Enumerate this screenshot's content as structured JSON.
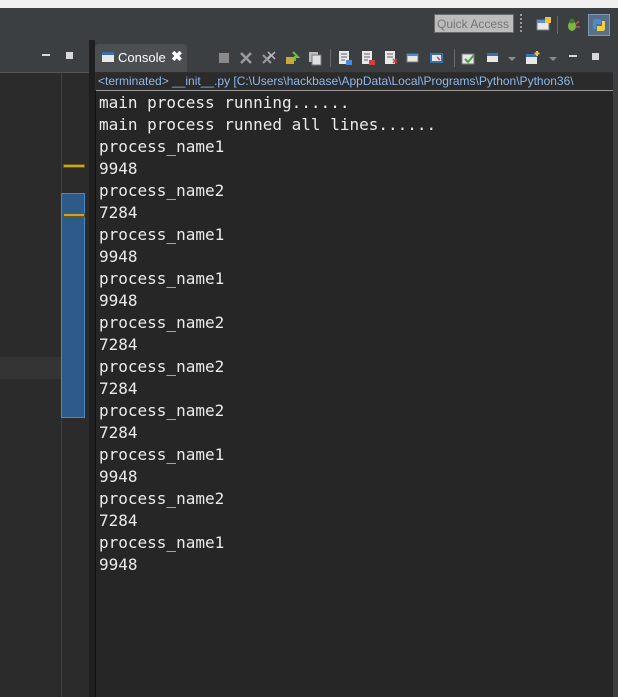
{
  "toolbar": {
    "quick_access_placeholder": "Quick Access",
    "icons": [
      "open-perspective-icon",
      "debug-perspective-icon",
      "python-perspective-icon"
    ]
  },
  "console": {
    "tab_label": "Console",
    "close_glyph": "✖",
    "toolbar_icons": [
      "terminate-icon",
      "remove-launch-icon",
      "remove-all-terminated-icon",
      "scroll-lock-icon",
      "clear-console-icon",
      "show-console-on-stdout-icon",
      "show-console-on-stderr-icon",
      "word-wrap-icon",
      "pin-console-icon",
      "display-selected-console-icon",
      "open-console-icon"
    ],
    "status": "<terminated> __init__.py [C:\\Users\\hackbase\\AppData\\Local\\Programs\\Python\\Python36\\",
    "lines": [
      "main process running......",
      "main process runned all lines......",
      "process_name1",
      "9948",
      "process_name2",
      "7284",
      "process_name1",
      "9948",
      "process_name1",
      "9948",
      "process_name2",
      "7284",
      "process_name2",
      "7284",
      "process_name2",
      "7284",
      "process_name1",
      "9948",
      "process_name2",
      "7284",
      "process_name1",
      "9948"
    ]
  },
  "colors": {
    "background": "#262626",
    "text": "#ebebeb",
    "status_text": "#8fb8e8",
    "overview": "#2e5a8a",
    "marker": "#c8a42a"
  }
}
